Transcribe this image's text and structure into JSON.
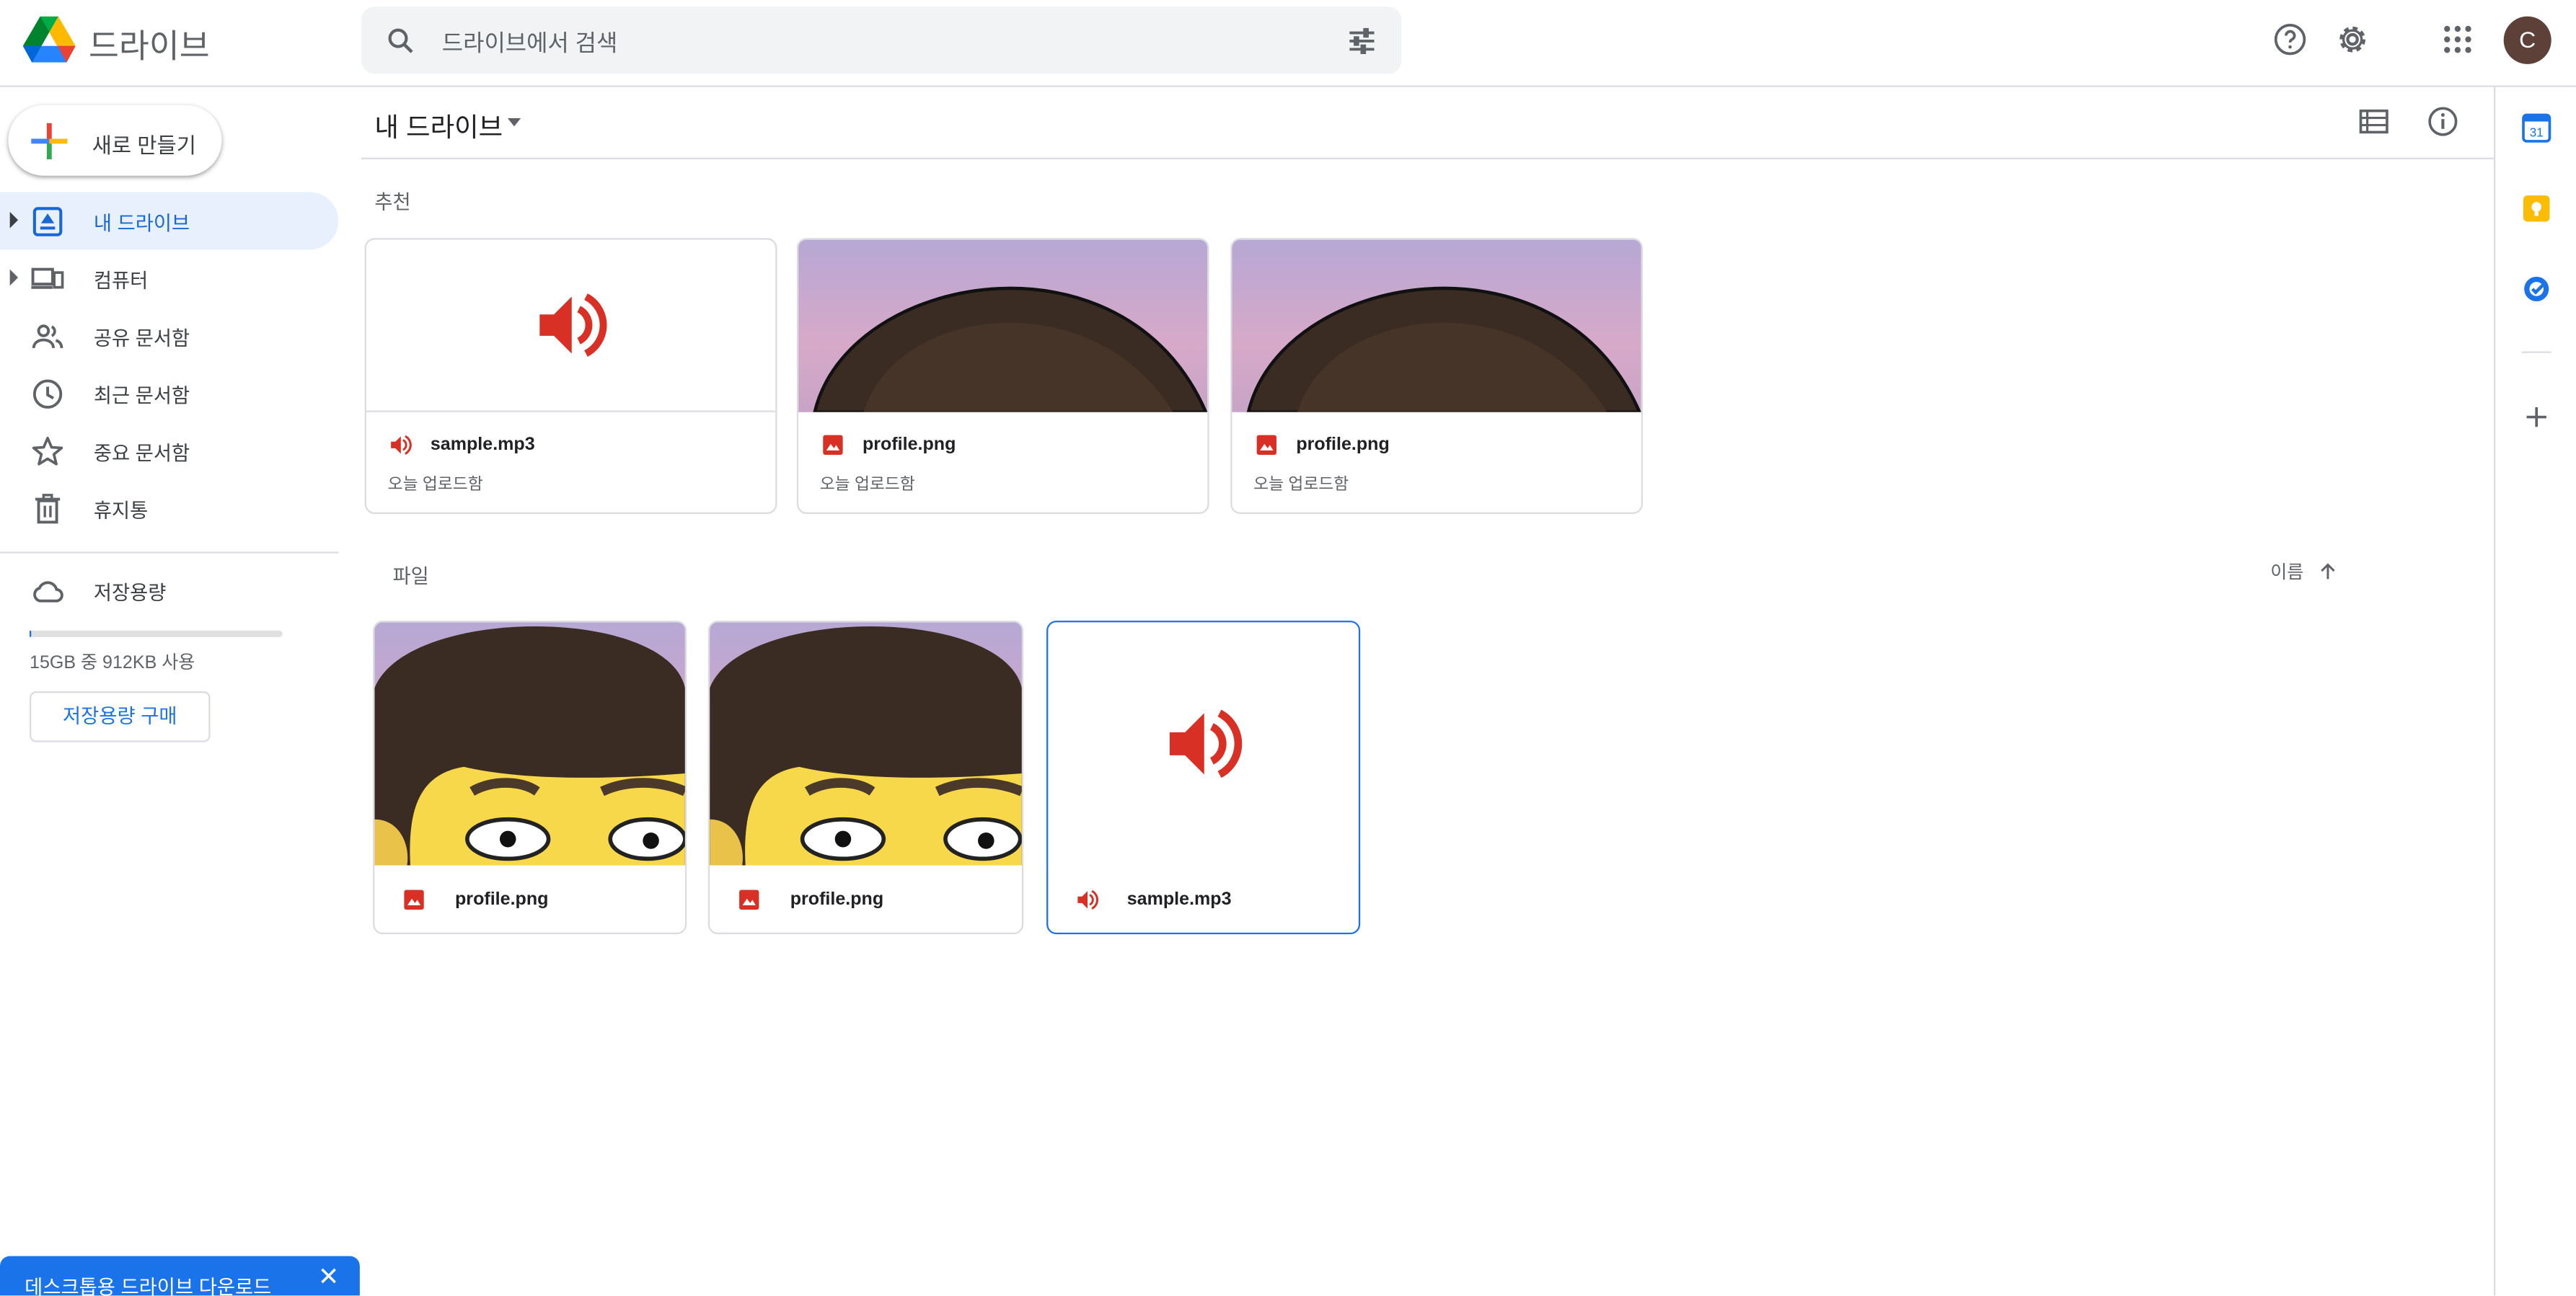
{
  "header": {
    "app_name": "드라이브",
    "search_placeholder": "드라이브에서 검색",
    "avatar_letter": "C"
  },
  "sidebar": {
    "new_label": "새로 만들기",
    "items": [
      {
        "label": "내 드라이브",
        "icon": "my-drive-icon",
        "active": true,
        "expandable": true
      },
      {
        "label": "컴퓨터",
        "icon": "computers-icon",
        "active": false,
        "expandable": true
      },
      {
        "label": "공유 문서함",
        "icon": "shared-icon",
        "active": false,
        "expandable": false
      },
      {
        "label": "최근 문서함",
        "icon": "clock-icon",
        "active": false,
        "expandable": false
      },
      {
        "label": "중요 문서함",
        "icon": "star-icon",
        "active": false,
        "expandable": false
      },
      {
        "label": "휴지통",
        "icon": "trash-icon",
        "active": false,
        "expandable": false
      }
    ],
    "storage": {
      "label": "저장용량",
      "usage_text": "15GB 중 912KB 사용",
      "used_fraction": 6e-05,
      "buy_label": "저장용량 구매"
    }
  },
  "main": {
    "title": "내 드라이브",
    "suggested": {
      "label": "추천",
      "cards": [
        {
          "name": "sample.mp3",
          "type": "audio",
          "subtitle": "오늘 업로드함"
        },
        {
          "name": "profile.png",
          "type": "image",
          "subtitle": "오늘 업로드함"
        },
        {
          "name": "profile.png",
          "type": "image",
          "subtitle": "오늘 업로드함"
        }
      ]
    },
    "files": {
      "label": "파일",
      "sort_label": "이름",
      "cards": [
        {
          "name": "profile.png",
          "type": "image"
        },
        {
          "name": "profile.png",
          "type": "image"
        },
        {
          "name": "sample.mp3",
          "type": "audio",
          "selected": true
        }
      ]
    }
  },
  "right_rail": {
    "calendar_day": "31",
    "icons": [
      "calendar-icon",
      "keep-icon",
      "tasks-icon",
      "add-icon"
    ]
  },
  "banner": {
    "text": "데스크톱용 드라이브 다운로드"
  },
  "colors": {
    "accent": "#1a73e8",
    "active_bg": "#e8f0fe",
    "file_red": "#d93025"
  }
}
